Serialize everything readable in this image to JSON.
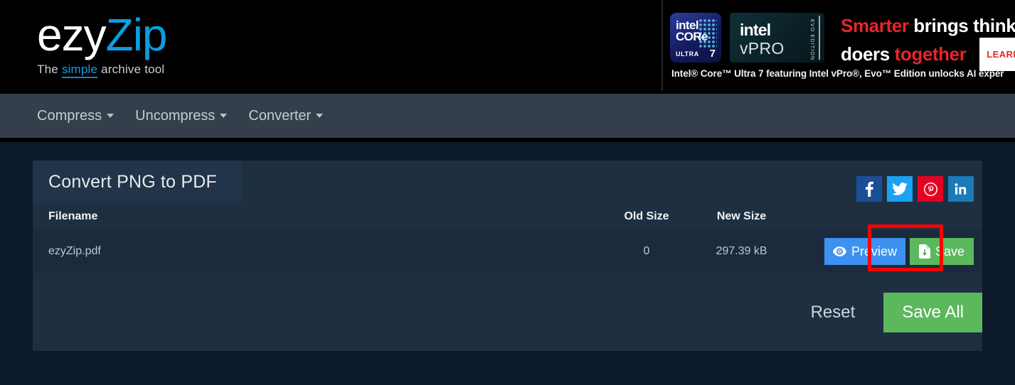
{
  "brand": {
    "logo_primary": "ezy",
    "logo_accent": "Zip",
    "tagline_pre": "The ",
    "tagline_accent": "simple",
    "tagline_post": " archive tool",
    "accent_color": "#0a9ee0"
  },
  "ad": {
    "badge_core_line1": "intel",
    "badge_core_line2": "CORe",
    "badge_core_line3": "ULTRA",
    "badge_core_number": "7",
    "badge_vpro_line1": "intel",
    "badge_vpro_line2": "vPRO",
    "badge_vpro_edition": "EVO EDITION",
    "headline_1a": "Smarter",
    "headline_1b": " brings thinke",
    "headline_2a": "doers ",
    "headline_2b": "together",
    "cta_label": "LEARN",
    "disclaimer": "Intel® Core™ Ultra 7 featuring Intel vPro®, Evo™ Edition unlocks AI exper",
    "red": "#e8252a"
  },
  "nav": {
    "items": [
      {
        "label": "Compress"
      },
      {
        "label": "Uncompress"
      },
      {
        "label": "Converter"
      }
    ]
  },
  "card": {
    "title": "Convert PNG to PDF",
    "social": [
      {
        "name": "facebook",
        "glyph": "f"
      },
      {
        "name": "twitter",
        "glyph": "ᴠ"
      },
      {
        "name": "pinterest",
        "glyph": "P"
      },
      {
        "name": "linkedin",
        "glyph": "in"
      }
    ],
    "table": {
      "columns": [
        "Filename",
        "Old Size",
        "New Size"
      ],
      "rows": [
        {
          "filename": "ezyZip.pdf",
          "old_size": "0",
          "new_size": "297.39 kB",
          "preview_label": "Preview",
          "save_label": "Save"
        }
      ]
    },
    "actions": {
      "reset_label": "Reset",
      "save_all_label": "Save All"
    },
    "colors": {
      "preview_button": "#3d91f0",
      "save_button": "#5cb85c",
      "highlight": "#ff0000"
    }
  }
}
